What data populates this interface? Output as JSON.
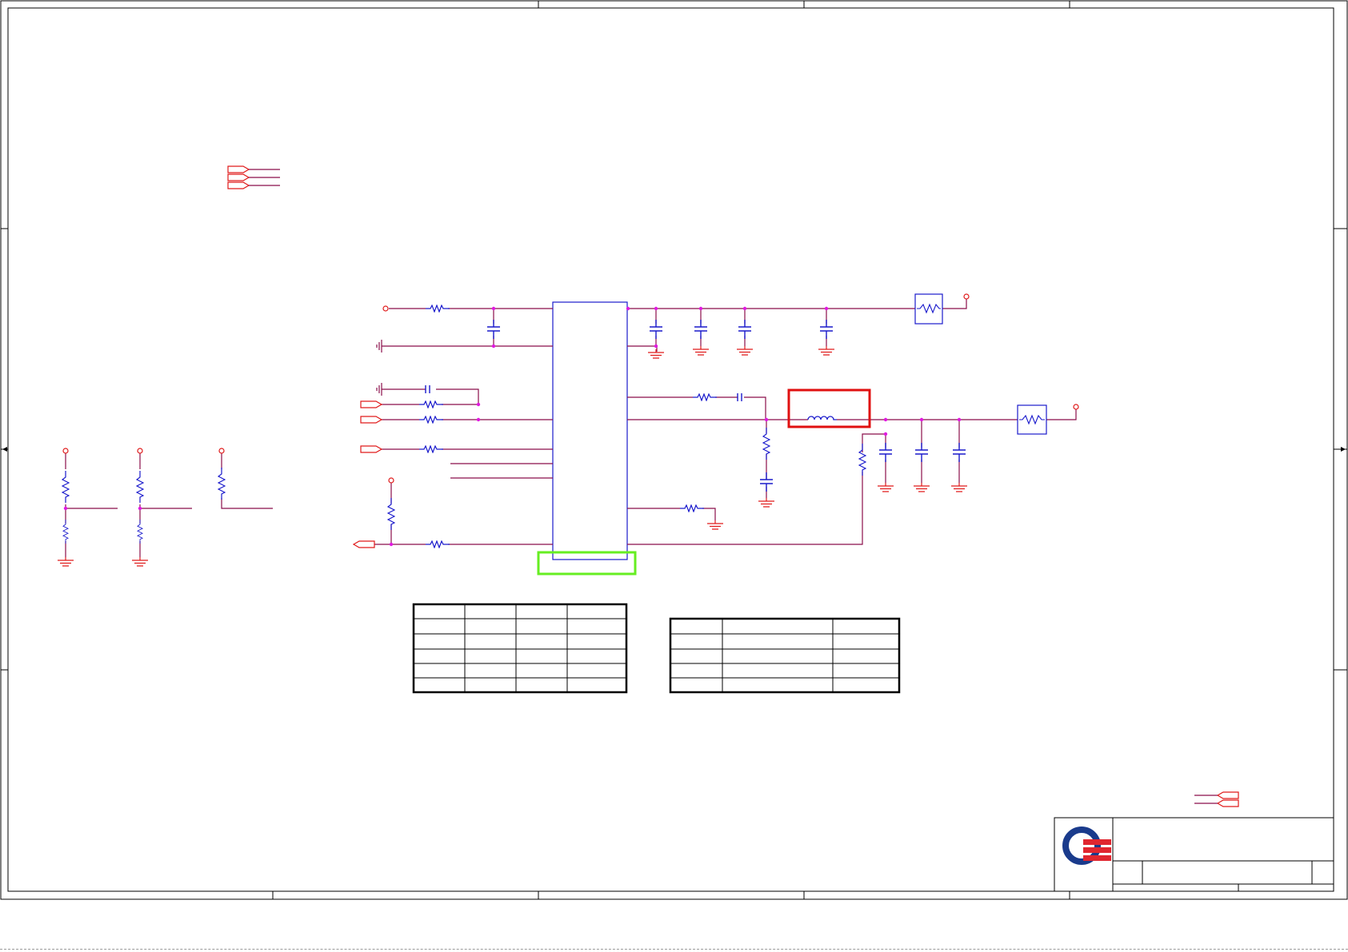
{
  "sheet": {
    "colors": {
      "border": "#000000",
      "wire": "#8b0f4b",
      "part": "#1a1acc",
      "port": "#e01a1a",
      "junction": "#e01ae0",
      "highlight_red": "#e01010",
      "highlight_green": "#66ee22",
      "logo_blue": "#1a3b8c",
      "logo_red": "#e0262f"
    },
    "icons": {
      "company_logo": "q-logo-icon",
      "resistor": "resistor-icon",
      "capacitor": "capacitor-icon",
      "inductor": "inductor-icon",
      "ferrite_bead": "bead-icon",
      "ground": "ground-icon",
      "chassis_ground": "chassis-ground-icon",
      "power_pin": "power-pin-icon",
      "off_page_connector": "offpage-connector-icon"
    },
    "notes": []
  }
}
